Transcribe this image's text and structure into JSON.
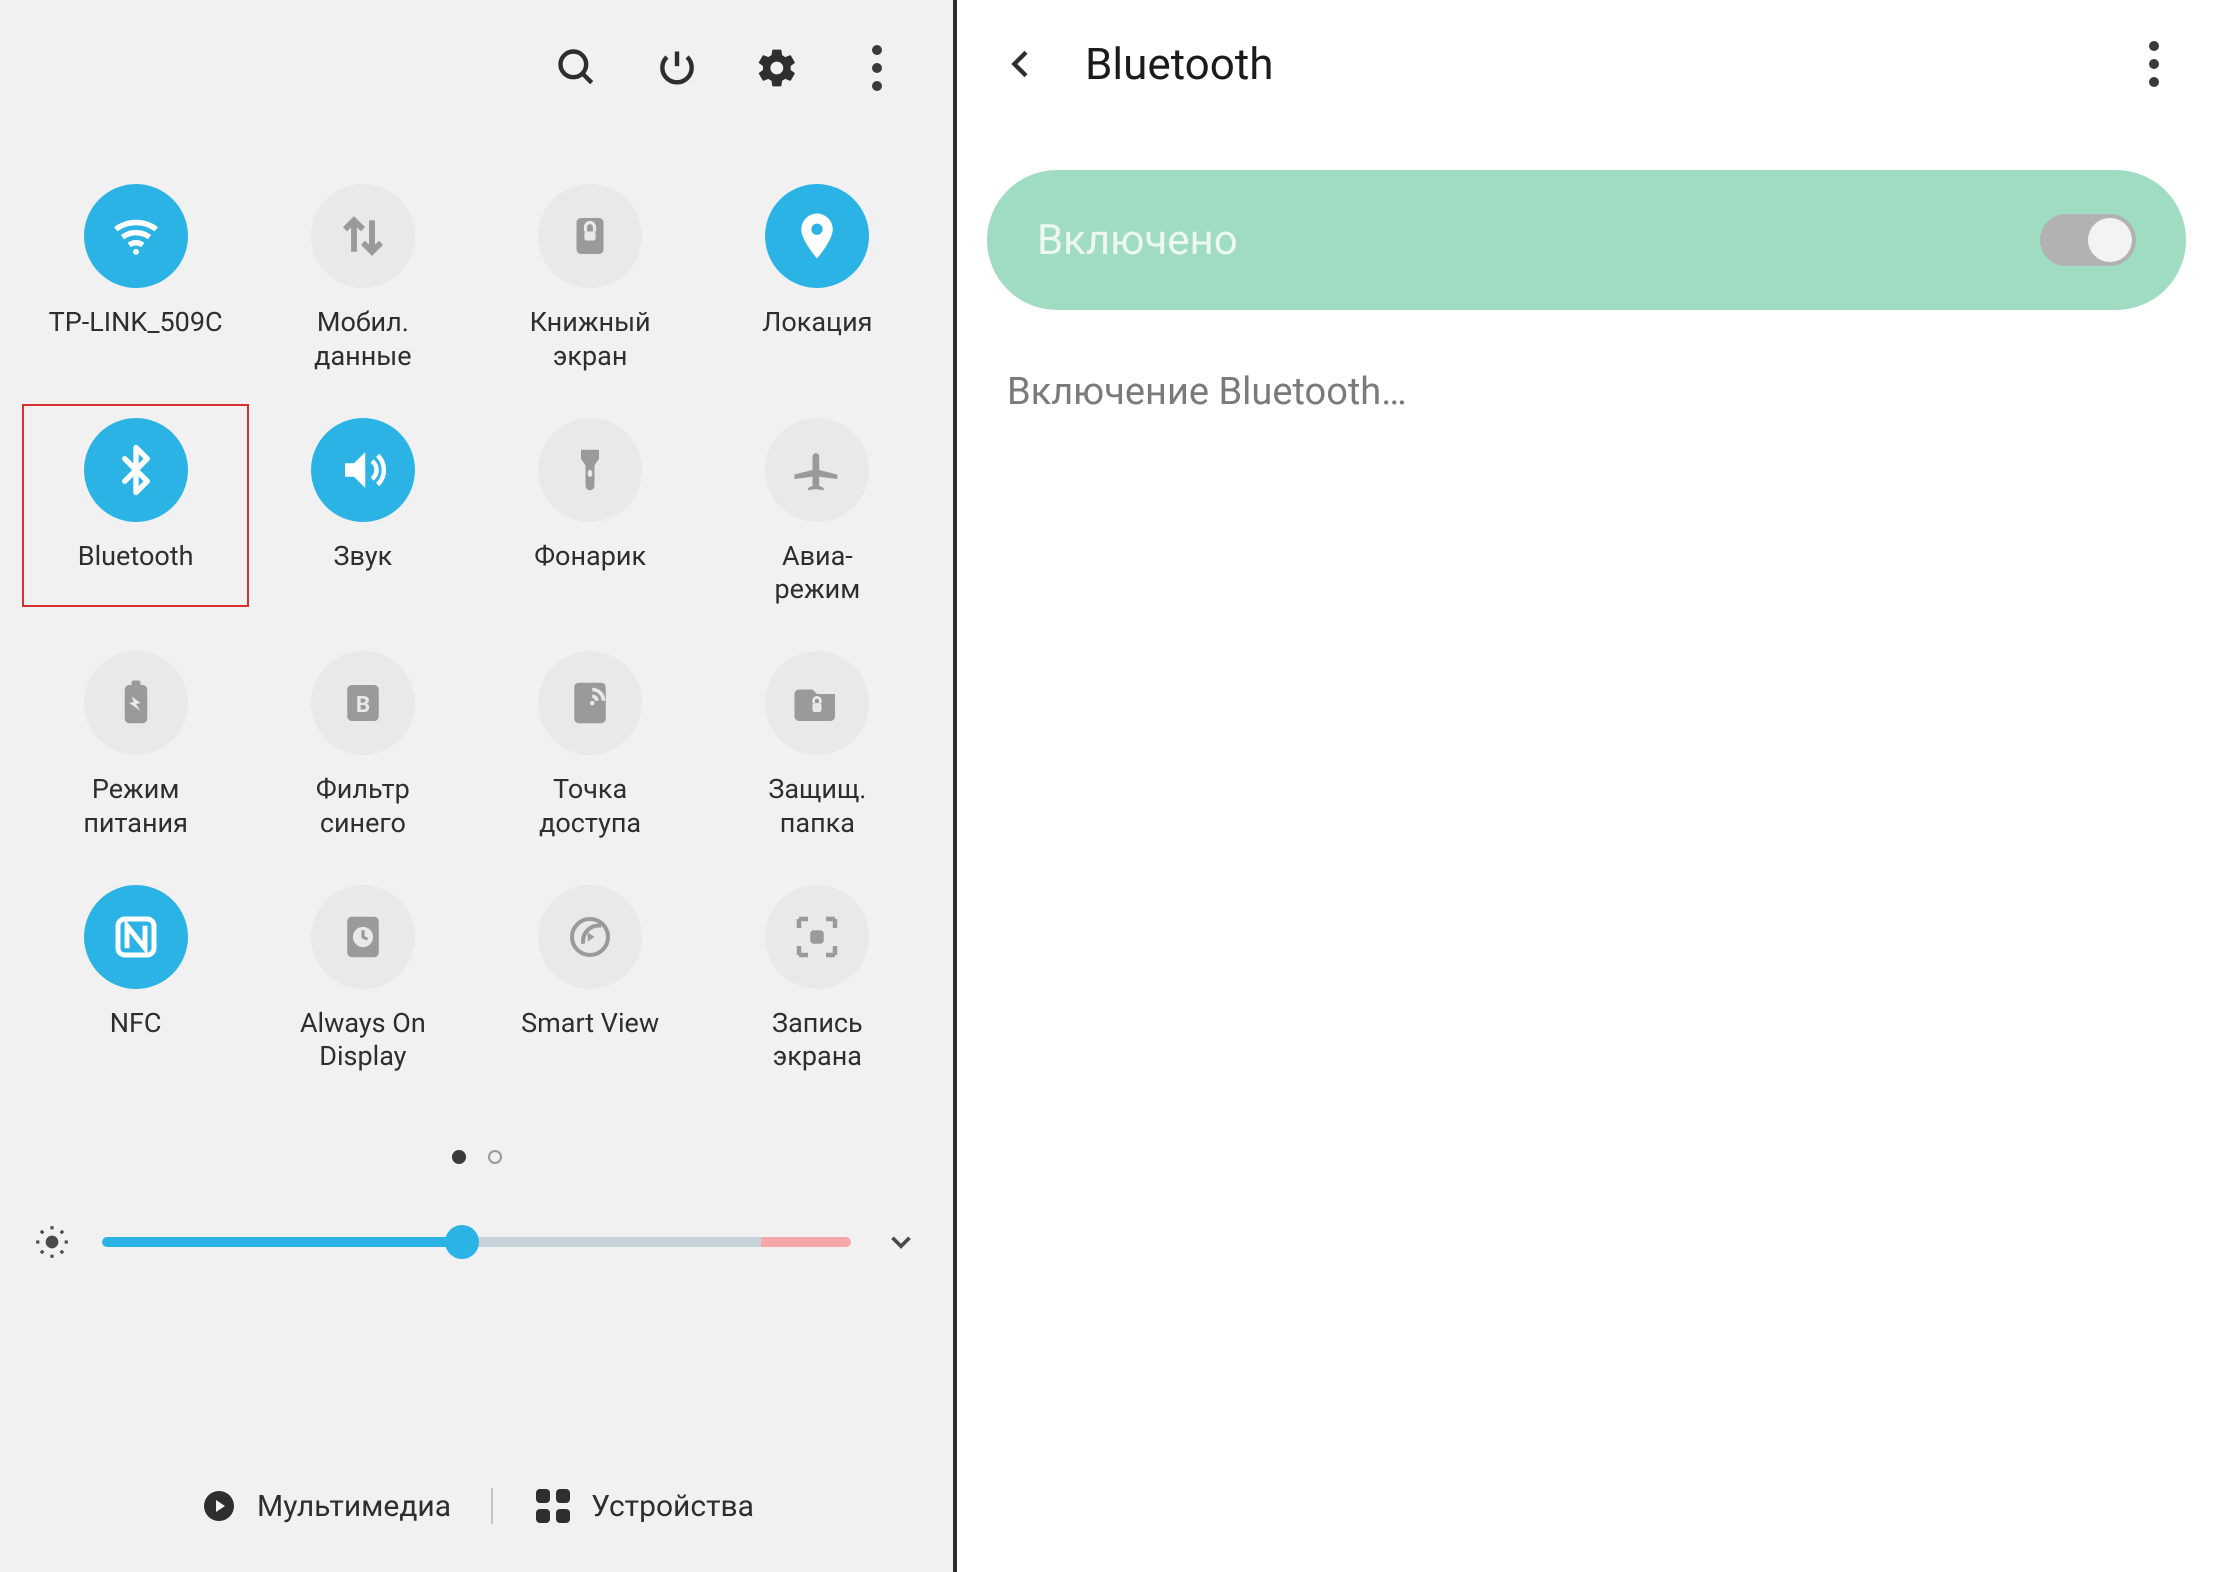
{
  "left": {
    "toolbar": {
      "search": "search",
      "power": "power",
      "settings": "settings",
      "more": "more"
    },
    "tiles": [
      {
        "id": "wifi",
        "label": "TP-LINK_509C",
        "active": true,
        "icon": "wifi"
      },
      {
        "id": "mobile-data",
        "label": "Мобил.\nданные",
        "active": false,
        "icon": "swap"
      },
      {
        "id": "book-screen",
        "label": "Книжный\nэкран",
        "active": false,
        "icon": "lock"
      },
      {
        "id": "location",
        "label": "Локация",
        "active": true,
        "icon": "location"
      },
      {
        "id": "bluetooth",
        "label": "Bluetooth",
        "active": true,
        "icon": "bluetooth",
        "highlighted": true
      },
      {
        "id": "sound",
        "label": "Звук",
        "active": true,
        "icon": "sound"
      },
      {
        "id": "flashlight",
        "label": "Фонарик",
        "active": false,
        "icon": "flashlight"
      },
      {
        "id": "airplane",
        "label": "Авиа-\nрежим",
        "active": false,
        "icon": "airplane"
      },
      {
        "id": "power-mode",
        "label": "Режим\nпитания",
        "active": false,
        "icon": "battery"
      },
      {
        "id": "blue-filter",
        "label": "Фильтр\nсинего",
        "active": false,
        "icon": "blue-filter"
      },
      {
        "id": "hotspot",
        "label": "Точка\nдоступа",
        "active": false,
        "icon": "hotspot"
      },
      {
        "id": "secure-folder",
        "label": "Защищ.\nпапка",
        "active": false,
        "icon": "secure-folder"
      },
      {
        "id": "nfc",
        "label": "NFC",
        "active": true,
        "icon": "nfc"
      },
      {
        "id": "aod",
        "label": "Always On\nDisplay",
        "active": false,
        "icon": "clock"
      },
      {
        "id": "smart-view",
        "label": "Smart View",
        "active": false,
        "icon": "smartview"
      },
      {
        "id": "screen-record",
        "label": "Запись\nэкрана",
        "active": false,
        "icon": "record"
      }
    ],
    "pager": {
      "total": 2,
      "current": 0
    },
    "brightness": {
      "value": 48
    },
    "footer": {
      "media": "Мультимедиа",
      "devices": "Устройства"
    }
  },
  "right": {
    "title": "Bluetooth",
    "toggle_state": "Включено",
    "toggle_on": true,
    "status": "Включение Bluetooth…"
  },
  "colors": {
    "accent": "#2bb3e6",
    "mint": "#9fdcc2",
    "highlight_border": "#d93030"
  }
}
